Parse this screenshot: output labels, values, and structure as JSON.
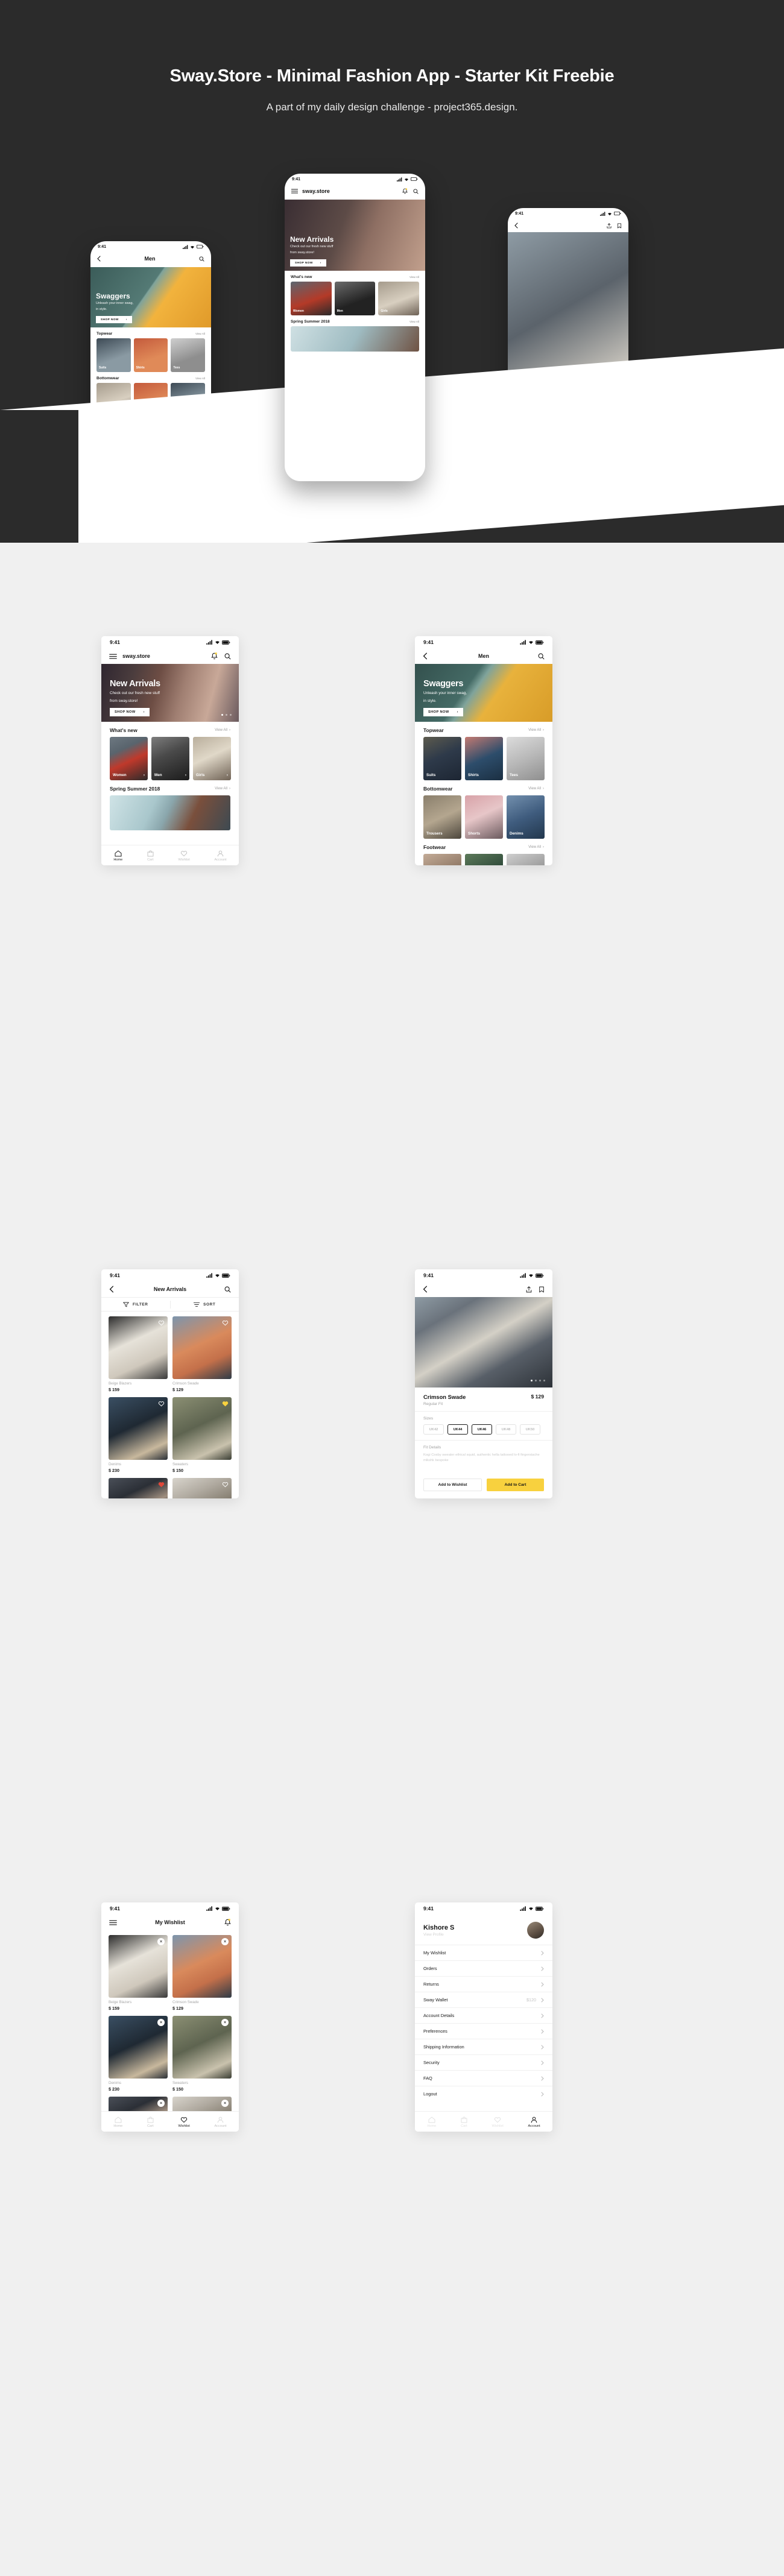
{
  "hero": {
    "title": "Sway.Store - Minimal Fashion App - Starter Kit Freebie",
    "subtitle": "A part of my daily design challenge - project365.design."
  },
  "status_bar": {
    "time": "9:41"
  },
  "icons": {
    "menu": "hamburger-menu-icon",
    "search": "search-icon",
    "bell": "notification-bell-icon",
    "back": "chevron-left-icon",
    "chevron": "chevron-right-icon",
    "share": "share-icon",
    "bookmark": "bookmark-icon",
    "filter": "filter-funnel-icon",
    "sort": "sort-icon",
    "heart": "heart-icon",
    "close": "close-x-icon"
  },
  "screens": {
    "home": {
      "brand": "sway.store",
      "banner": {
        "heading": "New Arrivals",
        "sub_line1": "Check out our fresh new stuff",
        "sub_line2": "from sway.store!",
        "cta": "SHOP NOW",
        "dots_total": 3,
        "dots_active": 1
      },
      "sections": [
        {
          "title": "What's new",
          "view_all": "View All",
          "cards": [
            {
              "label": "Women"
            },
            {
              "label": "Men"
            },
            {
              "label": "Girls"
            }
          ]
        },
        {
          "title": "Spring Summer 2018",
          "view_all": "View All",
          "cards": []
        }
      ],
      "tabs": [
        {
          "label": "Home",
          "icon": "home-icon",
          "active": true
        },
        {
          "label": "Cart",
          "icon": "cart-icon",
          "active": false
        },
        {
          "label": "Wishlist",
          "icon": "heart-icon",
          "active": false
        },
        {
          "label": "Account",
          "icon": "person-icon",
          "active": false
        }
      ]
    },
    "men": {
      "title": "Men",
      "banner": {
        "heading": "Swaggers",
        "sub_line1": "Unleash your inner swag,",
        "sub_line2": "in style.",
        "cta": "SHOP NOW"
      },
      "sections": [
        {
          "title": "Topwear",
          "view_all": "View All",
          "cards": [
            {
              "label": "Suits"
            },
            {
              "label": "Shirts"
            },
            {
              "label": "Tees"
            }
          ]
        },
        {
          "title": "Bottomwear",
          "view_all": "View All",
          "cards": [
            {
              "label": "Trousers"
            },
            {
              "label": "Shorts"
            },
            {
              "label": "Denims"
            }
          ]
        },
        {
          "title": "Footwear",
          "view_all": "View All",
          "cards": [
            {
              "label": ""
            },
            {
              "label": ""
            },
            {
              "label": ""
            }
          ]
        }
      ]
    },
    "new_arrivals": {
      "title": "New Arrivals",
      "filter_label": "FILTER",
      "sort_label": "SORT",
      "products": [
        {
          "name": "Beige Blazers",
          "price": "$ 159",
          "wishlisted": false
        },
        {
          "name": "Crimson Swade",
          "price": "$ 129",
          "wishlisted": true
        },
        {
          "name": "Denims",
          "price": "$ 230",
          "wishlisted": false
        },
        {
          "name": "Sweaters",
          "price": "$ 150",
          "wishlisted": true
        },
        {
          "name": "",
          "price": "",
          "wishlisted": true
        },
        {
          "name": "",
          "price": "",
          "wishlisted": false
        }
      ]
    },
    "product": {
      "name": "Crimson Swade",
      "fit": "Regular Fit",
      "price": "$ 129",
      "sizes_label": "Sizes",
      "sizes": [
        {
          "label": "UK42",
          "selected": false
        },
        {
          "label": "UK44",
          "selected": true
        },
        {
          "label": "UK46",
          "selected": true
        },
        {
          "label": "UK48",
          "selected": false
        },
        {
          "label": "UK50",
          "selected": false
        }
      ],
      "fit_details_label": "Fit Details",
      "fit_details_text": "Kogi Cosby sweater ethical squid, authentic hella tattooed lo-fi fingerstache mlkshk bespoke",
      "wishlist_button": "Add to Wishlist",
      "cart_button": "Add to Cart",
      "accent_color": "#f8d13e",
      "dots_total": 4,
      "dots_active": 1
    },
    "wishlist": {
      "title": "My Wishlist",
      "products": [
        {
          "name": "Beige Blazers",
          "price": "$ 159"
        },
        {
          "name": "Crimson Swade",
          "price": "$ 129"
        },
        {
          "name": "Denims",
          "price": "$ 230"
        },
        {
          "name": "Sweaters",
          "price": "$ 150"
        },
        {
          "name": "",
          "price": ""
        },
        {
          "name": "",
          "price": ""
        }
      ],
      "tabs": [
        {
          "label": "Home",
          "active": false
        },
        {
          "label": "Cart",
          "active": false
        },
        {
          "label": "Wishlist",
          "active": true
        },
        {
          "label": "Account",
          "active": false
        }
      ]
    },
    "account": {
      "user_name": "Kishore S",
      "view_profile": "View Profile",
      "rows": [
        {
          "label": "My Wishlist",
          "value": ""
        },
        {
          "label": "Orders",
          "value": ""
        },
        {
          "label": "Returns",
          "value": ""
        },
        {
          "label": "Sway Wallet",
          "value": "$120"
        },
        {
          "label": "Account Details",
          "value": ""
        },
        {
          "label": "Preferences",
          "value": ""
        },
        {
          "label": "Shipping Information",
          "value": ""
        },
        {
          "label": "Security",
          "value": ""
        },
        {
          "label": "FAQ",
          "value": ""
        },
        {
          "label": "Logout",
          "value": ""
        }
      ],
      "tabs": [
        {
          "label": "Home",
          "active": false
        },
        {
          "label": "Cart",
          "active": false
        },
        {
          "label": "Wishlist",
          "active": false
        },
        {
          "label": "Account",
          "active": true
        }
      ]
    }
  }
}
